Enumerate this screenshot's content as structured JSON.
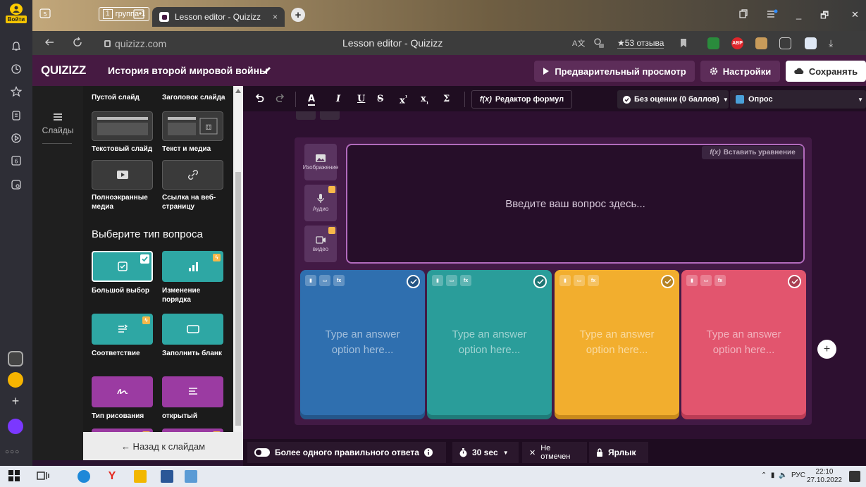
{
  "browser": {
    "login_label": "Войти",
    "group_tab": {
      "number": "1",
      "label": "группа 1"
    },
    "active_tab": {
      "title": "Lesson editor - Quizizz",
      "close": "×"
    },
    "url": "quizizz.com",
    "page_title": "Lesson editor - Quizizz",
    "reviews": "★53 отзыва",
    "window_controls": {
      "minimize": "_",
      "restore": "🗗",
      "close": "✕"
    }
  },
  "header": {
    "logo": "QUIZIZZ",
    "doc_title": "История второй мировой войны",
    "preview_label": "Предварительный просмотр",
    "settings_label": "Настройки",
    "save_label": "Сохранять"
  },
  "rail": {
    "slides_label": "Слайды"
  },
  "panel": {
    "slide_types": [
      {
        "label": "Пустой слайд"
      },
      {
        "label": "Заголовок слайда"
      },
      {
        "label": "Текстовый слайд"
      },
      {
        "label": "Текст и медиа"
      },
      {
        "label": "Полноэкранные медиа"
      },
      {
        "label": "Ссылка на веб-страницу"
      }
    ],
    "question_heading": "Выберите тип вопроса",
    "question_types": [
      {
        "label": "Большой выбор",
        "selected": true
      },
      {
        "label": "Изменение порядка"
      },
      {
        "label": "Соответствие"
      },
      {
        "label": "Заполнить бланк"
      },
      {
        "label": "Тип рисования"
      },
      {
        "label": "открытый"
      }
    ],
    "back_label": "← Назад к слайдам"
  },
  "toolbar": {
    "formula_label": "Редактор формул",
    "points_label": "Без оценки (0 баллов)",
    "type_label": "Опрос"
  },
  "editor": {
    "media": [
      "Изображение",
      "Аудио",
      "видео"
    ],
    "insert_equation": "Вставить уравнение",
    "question_placeholder": "Введите ваш вопрос здесь...",
    "answers": [
      {
        "text": "Type an answer option here...",
        "color": "#2f6faf"
      },
      {
        "text": "Type an answer option here...",
        "color": "#2a9d9a"
      },
      {
        "text": "Type an answer option here...",
        "color": "#f2ae2e"
      },
      {
        "text": "Type an answer option here...",
        "color": "#e2556e"
      }
    ]
  },
  "bottom_bar": {
    "multi_correct": "Более одного правильного ответа",
    "time": "30 sec",
    "not_marked": "Не отмечен",
    "tag": "Ярлык"
  },
  "taskbar": {
    "lang": "РУС",
    "time": "22:10",
    "date": "27.10.2022"
  },
  "colors": {
    "brand": "#461a42",
    "teal": "#2ea7a4",
    "purple": "#9b3ba2"
  }
}
